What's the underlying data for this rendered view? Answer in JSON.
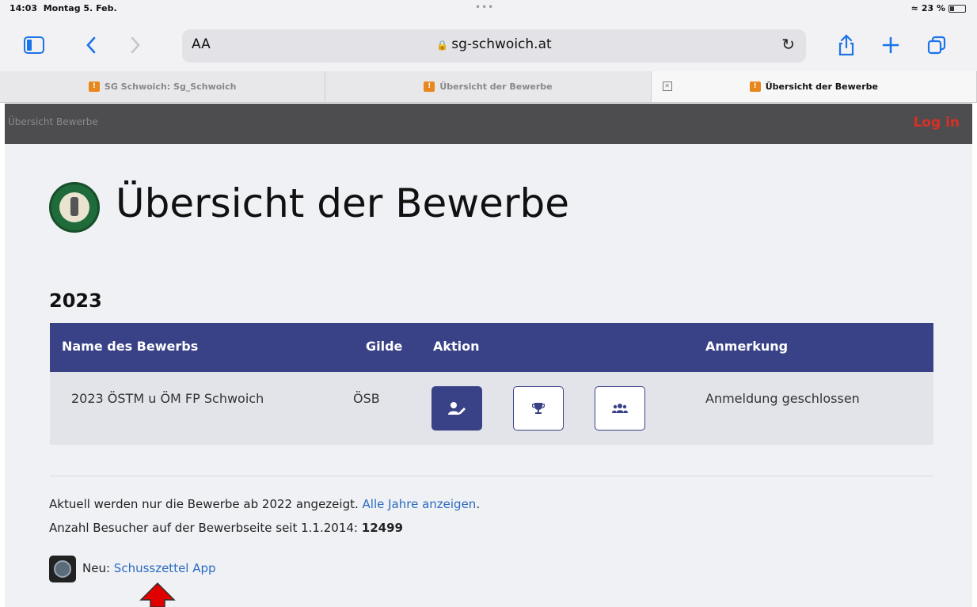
{
  "status_bar": {
    "time": "14:03",
    "date": "Montag 5. Feb.",
    "battery": "23 %"
  },
  "toolbar": {
    "text_size": "AA",
    "url": "sg-schwoich.at"
  },
  "tabs": [
    {
      "label": "SG Schwoich: Sg_Schwoich"
    },
    {
      "label": "Übersicht der Bewerbe"
    },
    {
      "label": "Übersicht der Bewerbe"
    }
  ],
  "site_header": {
    "brand": "Übersicht Bewerbe",
    "login": "Log in"
  },
  "page": {
    "title": "Übersicht der Bewerbe",
    "year": "2023",
    "table": {
      "headers": [
        "Name des Bewerbs",
        "Gilde",
        "Aktion",
        "Anmerkung"
      ],
      "rows": [
        {
          "name": "2023 ÖSTM u ÖM FP Schwoich",
          "gilde": "ÖSB",
          "anmerkung": "Anmeldung geschlossen"
        }
      ]
    },
    "info_text": "Aktuell werden nur die Bewerbe ab 2022 angezeigt.",
    "info_link": "Alle Jahre anzeigen",
    "info_dot": ".",
    "visitors_text": "Anzahl Besucher auf der Bewerbseite seit 1.1.2014:",
    "visitors_count": "12499",
    "new_prefix": "Neu:",
    "new_link": "Schusszettel App"
  },
  "colors": {
    "header_bg": "#3a4287",
    "login": "#d93025",
    "link": "#2a6bbf",
    "annotation_arrow": "#e00000"
  }
}
